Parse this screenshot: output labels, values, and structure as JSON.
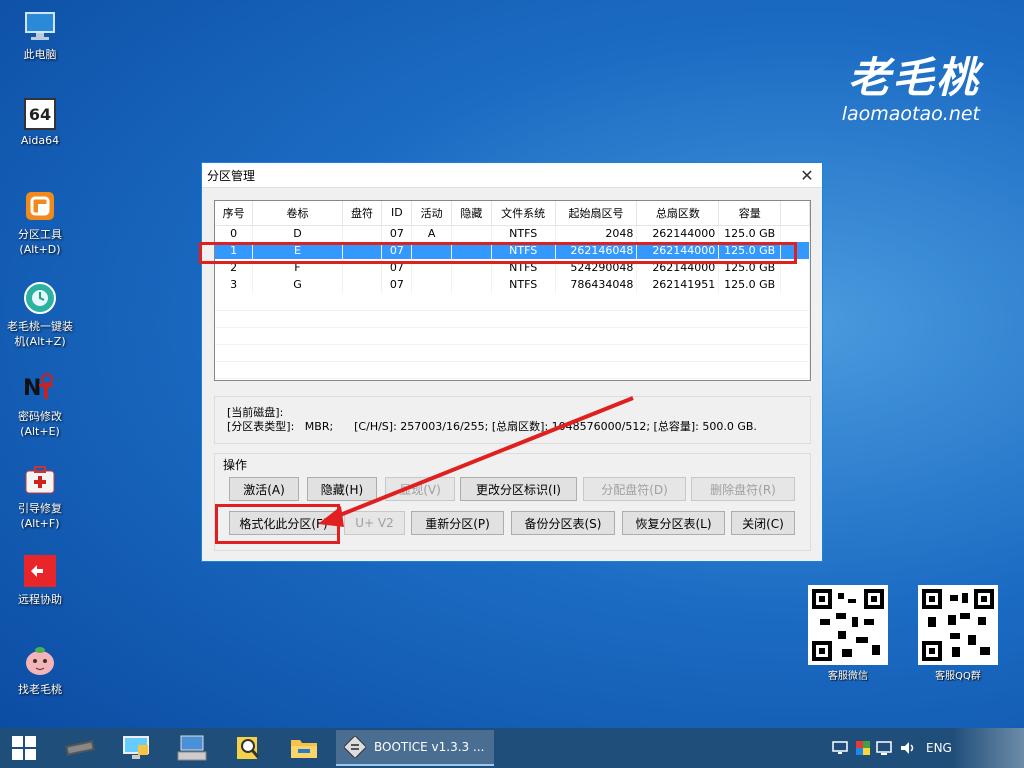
{
  "desktop": {
    "icons": [
      {
        "label": "此电脑",
        "icon": "computer-icon"
      },
      {
        "label": "Aida64",
        "icon": "aida64-icon",
        "badge": "64"
      },
      {
        "label": "分区工具\n(Alt+D)",
        "icon": "partition-tool-icon"
      },
      {
        "label": "老毛桃一键装\n机(Alt+Z)",
        "icon": "one-click-install-icon"
      },
      {
        "label": "密码修改\n(Alt+E)",
        "icon": "password-change-icon"
      },
      {
        "label": "引导修复\n(Alt+F)",
        "icon": "boot-repair-icon"
      },
      {
        "label": "远程协助",
        "icon": "remote-assist-icon"
      },
      {
        "label": "找老毛桃",
        "icon": "find-laomaotao-icon"
      }
    ]
  },
  "brand": {
    "cn": "老毛桃",
    "en": "laomaotao.net"
  },
  "window": {
    "title": "分区管理",
    "columns": [
      "序号",
      "卷标",
      "盘符",
      "ID",
      "活动",
      "隐藏",
      "文件系统",
      "起始扇区号",
      "总扇区数",
      "容量"
    ],
    "rows": [
      {
        "idx": "0",
        "label": "D",
        "drive": "",
        "id": "07",
        "active": "A",
        "hidden": "",
        "fs": "NTFS",
        "start": "2048",
        "total": "262144000",
        "size": "125.0 GB"
      },
      {
        "idx": "1",
        "label": "E",
        "drive": "",
        "id": "07",
        "active": "",
        "hidden": "",
        "fs": "NTFS",
        "start": "262146048",
        "total": "262144000",
        "size": "125.0 GB"
      },
      {
        "idx": "2",
        "label": "F",
        "drive": "",
        "id": "07",
        "active": "",
        "hidden": "",
        "fs": "NTFS",
        "start": "524290048",
        "total": "262144000",
        "size": "125.0 GB"
      },
      {
        "idx": "3",
        "label": "G",
        "drive": "",
        "id": "07",
        "active": "",
        "hidden": "",
        "fs": "NTFS",
        "start": "786434048",
        "total": "262141951",
        "size": "125.0 GB"
      }
    ],
    "selected_row": 1,
    "info": {
      "line1": "[当前磁盘]:",
      "line2": "[分区表类型]:   MBR;      [C/H/S]: 257003/16/255; [总扇区数]: 1048576000/512; [总容量]: 500.0 GB."
    },
    "ops_label": "操作",
    "buttons": {
      "activate": "激活(A)",
      "hide": "隐藏(H)",
      "show": "显现(V)",
      "change_id": "更改分区标识(I)",
      "assign_letter": "分配盘符(D)",
      "delete_letter": "删除盘符(R)",
      "format": "格式化此分区(F)",
      "uv2": "U+ V2",
      "repartition": "重新分区(P)",
      "backup_table": "备份分区表(S)",
      "restore_table": "恢复分区表(L)",
      "close": "关闭(C)"
    },
    "close_glyph": "✕"
  },
  "qr": [
    {
      "label": "客服微信"
    },
    {
      "label": "客服QQ群"
    }
  ],
  "taskbar": {
    "active_app": "BOOTICE v1.3.3 ...",
    "lang": "ENG"
  },
  "colors": {
    "selection": "#3399ff",
    "highlight_red": "#e02020",
    "taskbar": "#1f4e7a"
  }
}
